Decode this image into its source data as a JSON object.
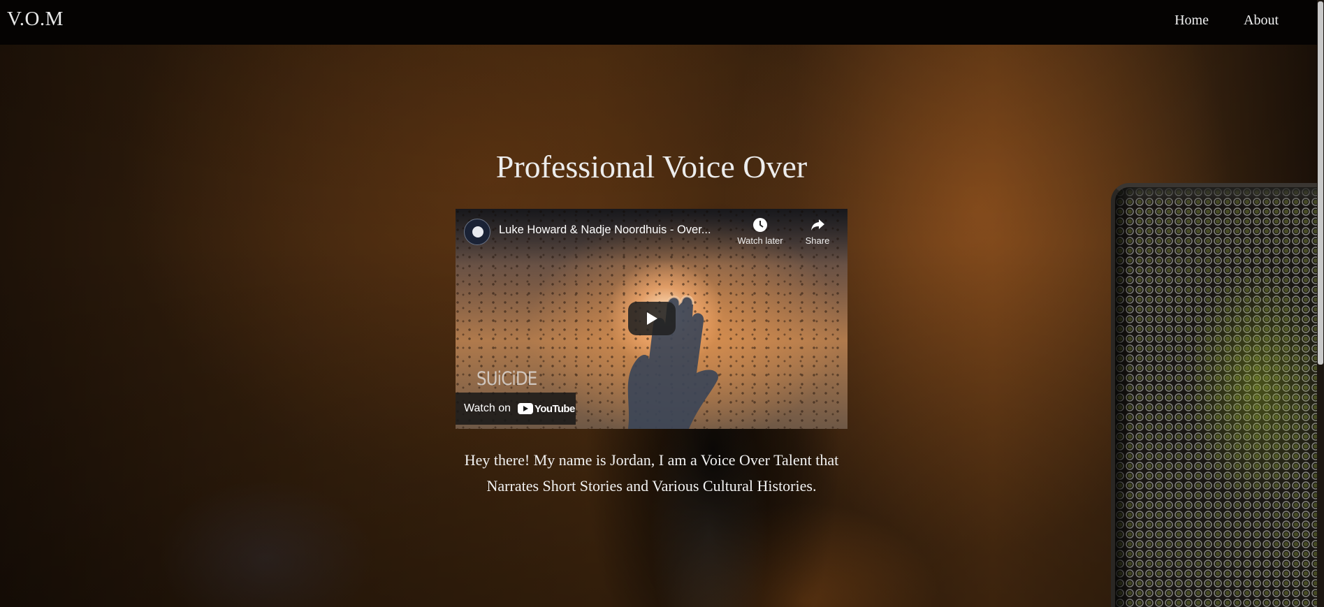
{
  "navbar": {
    "brand": "V.O.M",
    "links": [
      {
        "label": "Home"
      },
      {
        "label": "About"
      }
    ]
  },
  "hero": {
    "title": "Professional Voice Over",
    "bio": "Hey there! My name is Jordan, I am a Voice Over Talent that Narrates Short Stories and Various Cultural Histories."
  },
  "video": {
    "title": "Luke Howard & Nadje Noordhuis - Over...",
    "watch_later_label": "Watch later",
    "share_label": "Share",
    "watch_on_label": "Watch on",
    "platform_label": "YouTube",
    "thumbnail_text": "SUiCiDE",
    "play_icon": "play-icon"
  },
  "colors": {
    "navbar_bg": "#050302",
    "text": "#ececec"
  }
}
